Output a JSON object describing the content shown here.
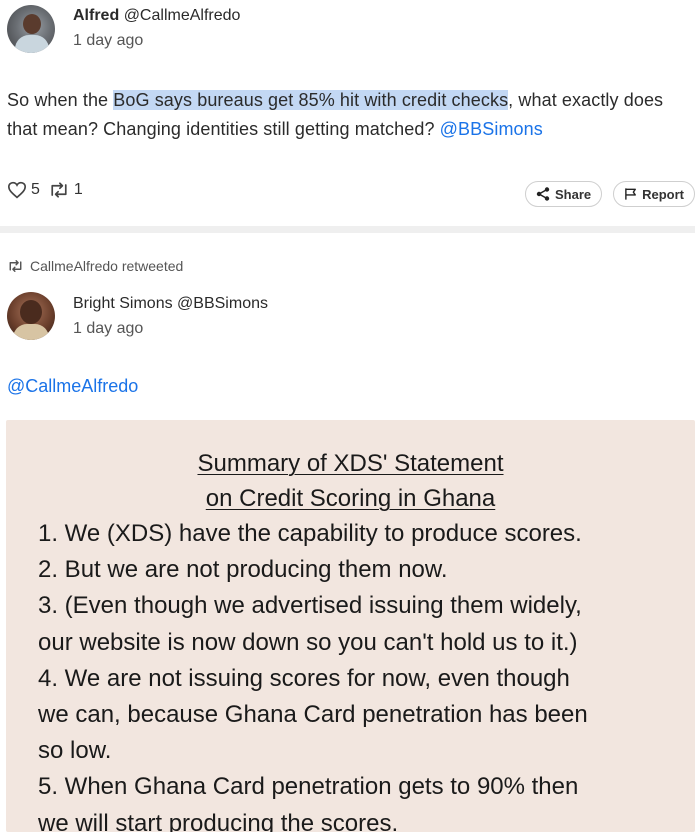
{
  "post1": {
    "author_name": "Alfred",
    "author_handle": "@CallmeAlfredo",
    "time": "1 day ago",
    "text_before": "So when the ",
    "text_highlight": "BoG says bureaus get 85% hit with credit checks",
    "text_after": ", what exactly does that mean? Changing identities still getting matched? ",
    "mention": "@BBSimons",
    "likes": "5",
    "retweets": "1",
    "share_label": "Share",
    "report_label": "Report"
  },
  "retweet": {
    "label": "CallmeAlfredo retweeted"
  },
  "post2": {
    "author_name": "Bright Simons",
    "author_handle": "@BBSimons",
    "time": "1 day ago",
    "reply_mention": "@CallmeAlfredo",
    "image": {
      "title_line1": "Summary of XDS' Statement",
      "title_line2": "on Credit Scoring in Ghana",
      "lines": [
        "1. We (XDS) have the capability to produce scores.",
        "2. But we are not producing them now.",
        "3. (Even though we advertised issuing them widely,",
        "our website is now down so you can't hold us to it.)",
        "4. We are not issuing scores for now, even though",
        "we can, because Ghana Card penetration has been",
        "so low.",
        "5. When Ghana Card penetration gets to 90% then",
        "we will start producing the scores."
      ]
    }
  },
  "colors": {
    "accent": "#1a73e8",
    "highlight": "#c3d8f4",
    "image_bg": "#f2e6df"
  },
  "icons": [
    "heart-outline-icon",
    "retweet-icon",
    "share-icon",
    "flag-icon"
  ]
}
